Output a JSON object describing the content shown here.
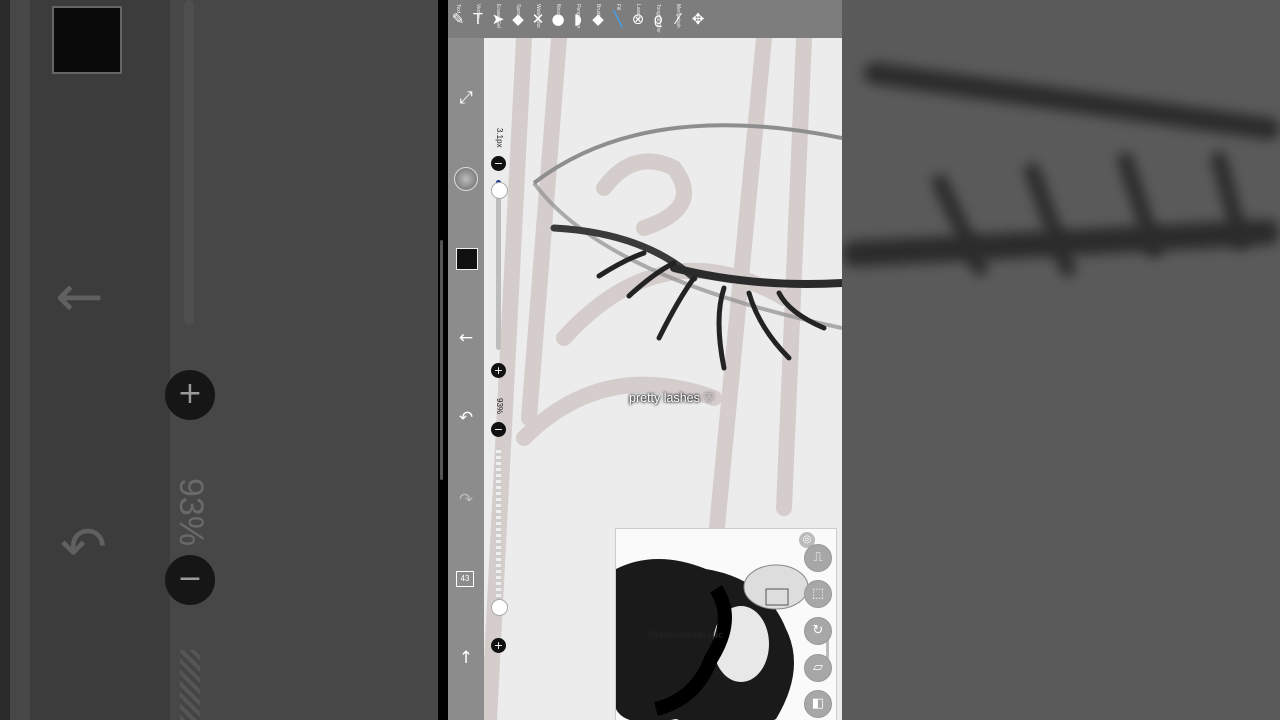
{
  "toolbar": {
    "tools": [
      {
        "icon": "pen-icon",
        "glyph": "✎",
        "label": "Text"
      },
      {
        "icon": "text-icon",
        "glyph": "T",
        "label": "Vector"
      },
      {
        "icon": "cursor-icon",
        "glyph": "➤",
        "label": "Eraser Gel"
      },
      {
        "icon": "eraser-icon",
        "glyph": "◆",
        "label": "Special"
      },
      {
        "icon": "wand-icon",
        "glyph": "✕",
        "label": "Watercolor"
      },
      {
        "icon": "smudge-icon",
        "glyph": "●",
        "label": "Noiza"
      },
      {
        "icon": "blur-icon",
        "glyph": "◗",
        "label": "Pengerhan"
      },
      {
        "icon": "fill-icon",
        "glyph": "◆",
        "label": "Brush"
      },
      {
        "icon": "brush-icon",
        "glyph": "╲",
        "label": "Fill"
      },
      {
        "icon": "close-circle-icon",
        "glyph": "⊗",
        "label": "Lasso"
      },
      {
        "icon": "lasso-icon",
        "glyph": "ϱ",
        "label": "Tongkat Sihir"
      },
      {
        "icon": "magic-wand-icon",
        "glyph": "⁄",
        "label": "Mengubah"
      },
      {
        "icon": "move-icon",
        "glyph": "✥",
        "label": ""
      }
    ]
  },
  "sidebar": {
    "items": [
      {
        "name": "transform-icon",
        "glyph": "⤢"
      },
      {
        "name": "back-arrow-icon",
        "glyph": "←"
      },
      {
        "name": "undo-icon",
        "glyph": "↶"
      },
      {
        "name": "redo-icon",
        "glyph": "↷"
      },
      {
        "name": "up-arrow-icon",
        "glyph": "↑"
      }
    ],
    "layer_count": "43"
  },
  "brush_size": {
    "label": "3.1px",
    "level_percent": 5
  },
  "opacity": {
    "label": "93%",
    "level_percent": 93
  },
  "caption": "pretty lashes ♡",
  "preview": {
    "title": "Monochromatic"
  },
  "right_buttons": [
    {
      "name": "layer-settings-icon",
      "glyph": "⎍"
    },
    {
      "name": "selection-icon",
      "glyph": "⬚"
    },
    {
      "name": "rotate-icon",
      "glyph": "↻"
    },
    {
      "name": "ruler-icon",
      "glyph": "▱"
    },
    {
      "name": "reference-icon",
      "glyph": "◧"
    }
  ],
  "background_left": {
    "opacity_label": "93%"
  },
  "colors": {
    "accent": "#3aa7ff",
    "toolbar": "#7d7d7d",
    "sidebar": "#8c8c8c",
    "canvas": "#ececec"
  }
}
